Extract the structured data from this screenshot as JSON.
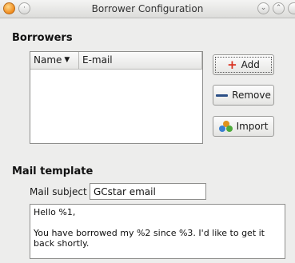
{
  "window": {
    "title": "Borrower Configuration",
    "icons": [
      "app-icon",
      "shade-icon",
      "minimize-icon",
      "maximize-icon"
    ]
  },
  "borrowers": {
    "section_title": "Borrowers",
    "columns": [
      {
        "label": "Name",
        "sort_indicator": "▼"
      },
      {
        "label": "E-mail"
      }
    ],
    "rows": [],
    "buttons": {
      "add": "Add",
      "remove": "Remove",
      "import": "Import"
    }
  },
  "mail_template": {
    "section_title": "Mail template",
    "subject_label": "Mail subject",
    "subject_value": "GCstar email",
    "body_value": "Hello %1,\n\nYou have borrowed my %2 since %3. I'd like to get it back shortly."
  },
  "colors": {
    "add_icon": "#d9301f",
    "remove_icon": "#2b4f86",
    "app_icon": "#f08a1c"
  }
}
